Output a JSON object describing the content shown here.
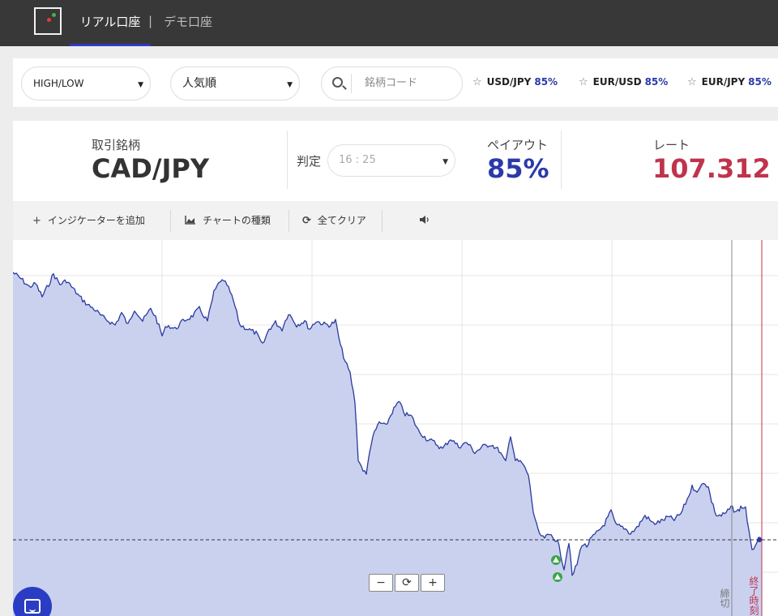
{
  "header": {
    "tabs": [
      {
        "label": "リアル口座",
        "active": true
      },
      {
        "label": "デモ口座",
        "active": false
      }
    ],
    "separator": "|"
  },
  "filters": {
    "trade_type": "HIGH/LOW",
    "sort": "人気順",
    "search_placeholder": "銘柄コード",
    "favorites": [
      {
        "pair": "USD/JPY",
        "payout": "85%"
      },
      {
        "pair": "EUR/USD",
        "payout": "85%"
      },
      {
        "pair": "EUR/JPY",
        "payout": "85%"
      }
    ]
  },
  "info": {
    "asset_label": "取引銘柄",
    "asset": "CAD/JPY",
    "expiry_label": "判定",
    "expiry_value": "16 : 25",
    "payout_label": "ペイアウト",
    "payout": "85%",
    "rate_label": "レート",
    "rate": "107.312"
  },
  "toolbar": {
    "add_indicator": "インジケーターを追加",
    "chart_type": "チャートの種類",
    "clear_all": "全てクリア"
  },
  "chart": {
    "deadline_label": "締切",
    "expiry_label": "終了時刻",
    "zoom_out": "−",
    "zoom_reset": "⟳",
    "zoom_in": "+"
  },
  "colors": {
    "accent": "#2b3cc4",
    "rate": "#c0334d",
    "line": "#2b3a9e",
    "fill": "#c9d1ef",
    "buy_marker": "#3aa548"
  }
}
